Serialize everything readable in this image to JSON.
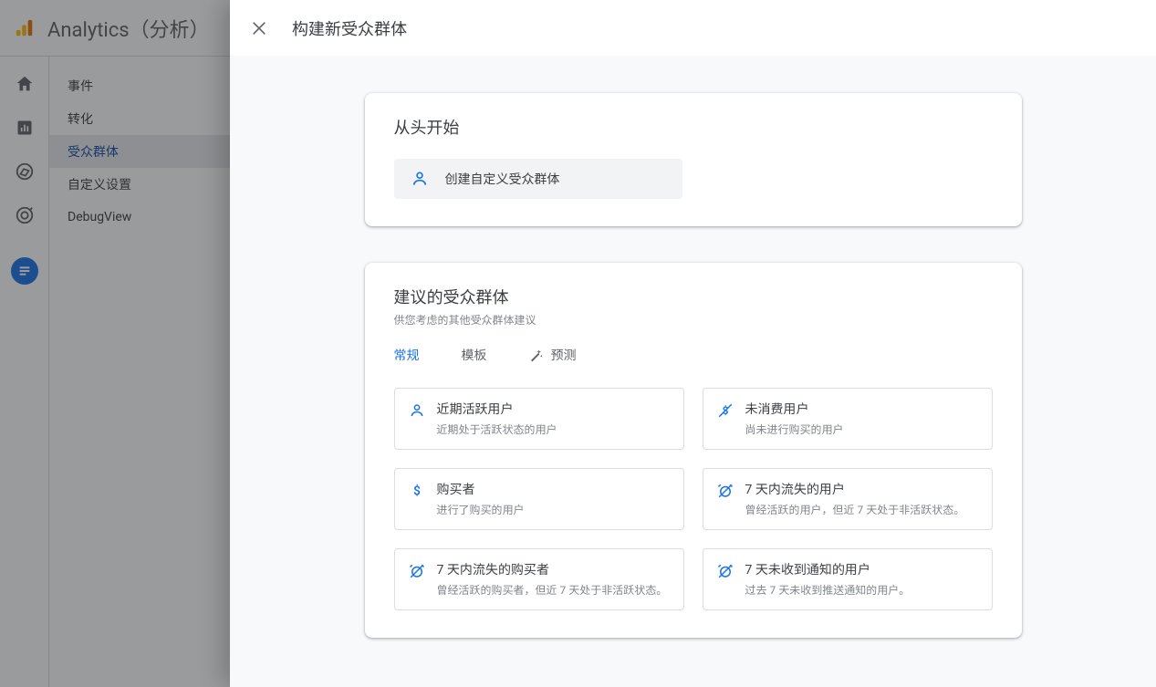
{
  "app": {
    "title": "Analytics（分析）"
  },
  "subnav": {
    "items": [
      {
        "label": "事件"
      },
      {
        "label": "转化"
      },
      {
        "label": "受众群体"
      },
      {
        "label": "自定义设置"
      },
      {
        "label": "DebugView"
      }
    ],
    "active_index": 2
  },
  "dialog": {
    "title": "构建新受众群体",
    "start": {
      "heading": "从头开始",
      "chip_label": "创建自定义受众群体"
    },
    "suggested": {
      "heading": "建议的受众群体",
      "subheading": "供您考虑的其他受众群体建议",
      "tabs": [
        {
          "label": "常规"
        },
        {
          "label": "模板"
        },
        {
          "label": "预测"
        }
      ],
      "active_tab": 0,
      "items": [
        {
          "icon": "person",
          "title": "近期活跃用户",
          "desc": "近期处于活跃状态的用户"
        },
        {
          "icon": "no-money",
          "title": "未消费用户",
          "desc": "尚未进行购买的用户"
        },
        {
          "icon": "dollar",
          "title": "购买者",
          "desc": "进行了购买的用户"
        },
        {
          "icon": "alarm-off",
          "title": "7 天内流失的用户",
          "desc": "曾经活跃的用户，但近 7 天处于非活跃状态。"
        },
        {
          "icon": "alarm-off",
          "title": "7 天内流失的购买者",
          "desc": "曾经活跃的购买者，但近 7 天处于非活跃状态。"
        },
        {
          "icon": "alarm-off",
          "title": "7 天未收到通知的用户",
          "desc": "过去 7 天未收到推送通知的用户。"
        }
      ]
    }
  }
}
